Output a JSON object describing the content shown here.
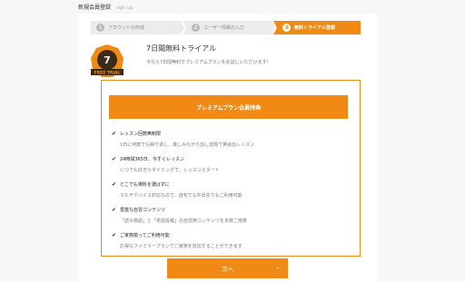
{
  "header": {
    "title": "新規会員登録",
    "sub": "sign up"
  },
  "steps": [
    {
      "num": "1",
      "label": "アカウントの作成"
    },
    {
      "num": "2",
      "label": "ユーザー情報の入力"
    },
    {
      "num": "3",
      "label": "無料トライアル登録"
    }
  ],
  "badge": {
    "number": "7",
    "label": "FREE TRIAL",
    "color": "#f08a14"
  },
  "trial": {
    "title": "7日間無料トライアル",
    "desc": "今なら7日間無料でプレミアムプランをお試しいただけます！"
  },
  "plan": {
    "button_label": "プレミアムプラン会員特典",
    "features": [
      {
        "title": "レッスン回数無制限",
        "desc": "1日に何度でも繰り返し、楽しみながら話し放題で英会話レッスン"
      },
      {
        "title": "24時間365日、今すぐレッスン",
        "desc": "いつでも好きなタイミングで、レッスンスタート"
      },
      {
        "title": "どこでも場所を選ばずに",
        "desc": "マルチデバイス対応なので、自宅でも外出先でもご利用可能"
      },
      {
        "title": "豊富な自習コンテンツ",
        "desc": "「読み物語」と「単語投稿」の自習用コンテンツを多数ご用意"
      },
      {
        "title": "ご家族揃ってご利用可能",
        "desc": "お得なファミリープランでご家族を追加することができます"
      }
    ]
  },
  "next": {
    "label": "次へ"
  },
  "colors": {
    "accent": "#f08a14"
  }
}
